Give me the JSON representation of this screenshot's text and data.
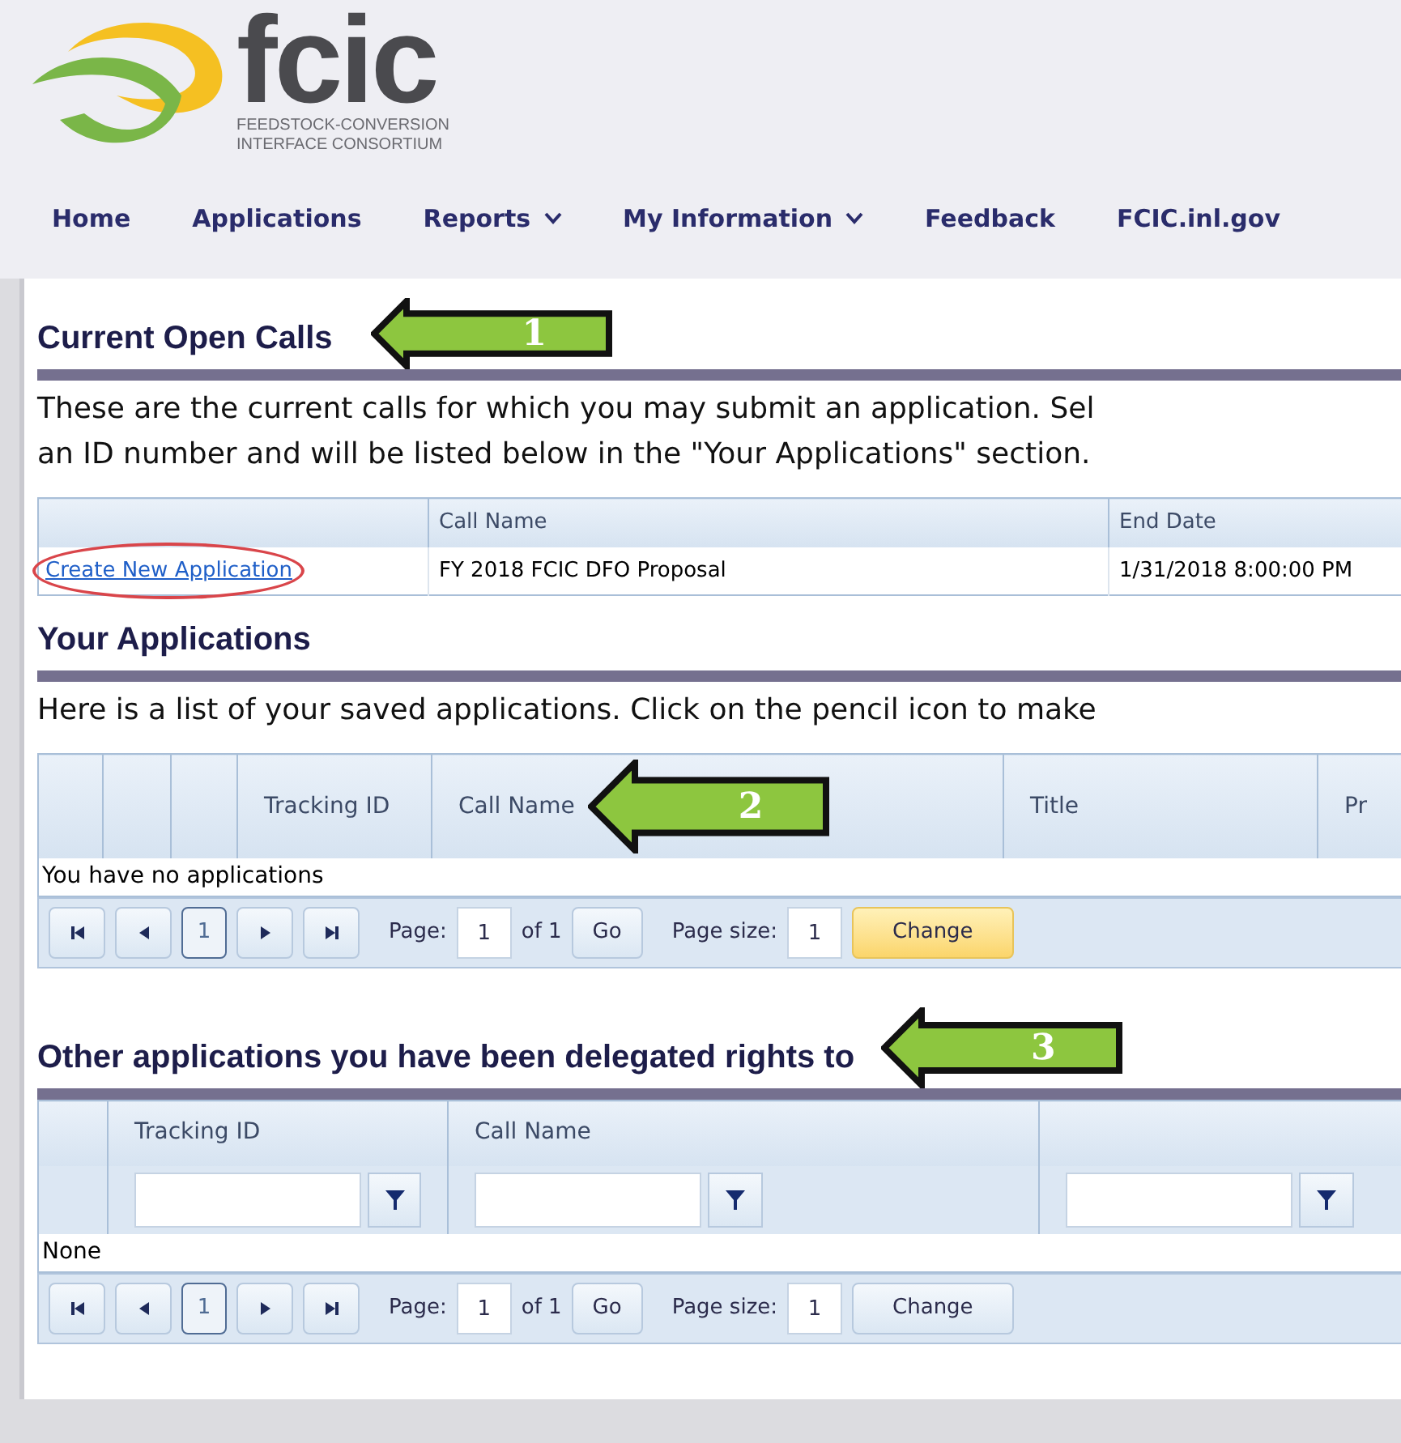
{
  "logo": {
    "name": "fcic",
    "tagline": [
      "FEEDSTOCK-CONVERSION",
      "INTERFACE CONSORTIUM"
    ]
  },
  "nav": [
    {
      "label": "Home",
      "has_menu": false
    },
    {
      "label": "Applications",
      "has_menu": false
    },
    {
      "label": "Reports",
      "has_menu": true
    },
    {
      "label": "My Information",
      "has_menu": true
    },
    {
      "label": "Feedback",
      "has_menu": false
    },
    {
      "label": "FCIC.inl.gov",
      "has_menu": false
    }
  ],
  "open_calls": {
    "title": "Current Open Calls",
    "callout": "1",
    "intro": [
      "These are the current calls for which you may submit an application. Sel",
      "an ID number and will be listed below in the \"Your Applications\" section."
    ],
    "columns": [
      {},
      {
        "label": "Call Name"
      },
      {
        "label": "End Date"
      }
    ],
    "rows": [
      {
        "link": "Create New Application",
        "circled": true,
        "call_name": "FY 2018 FCIC DFO Proposal",
        "end_date": "1/31/2018 8:00:00 PM"
      }
    ]
  },
  "your_applications": {
    "title": "Your Applications",
    "callout": "2",
    "intro": "Here is a list of your saved applications. Click on the pencil icon to make",
    "columns": [
      {},
      {},
      {},
      {
        "label": "Tracking ID"
      },
      {
        "label": "Call Name"
      },
      {
        "label": "Title"
      },
      {
        "label": "Pr"
      }
    ],
    "empty": "You have no applications",
    "pager": {
      "current": "1",
      "page_label": "Page:",
      "page_value": "1",
      "of": "of 1",
      "go": "Go",
      "size_label": "Page size:",
      "size_value": "1",
      "change": "Change",
      "change_highlighted": true
    }
  },
  "delegated": {
    "title": "Other applications you have been delegated rights to",
    "callout": "3",
    "columns": [
      {},
      {
        "label": "Tracking ID",
        "filter": true
      },
      {
        "label": "Call Name",
        "filter": true
      },
      {
        "filter": true
      }
    ],
    "empty": "None",
    "pager": {
      "current": "1",
      "page_label": "Page:",
      "page_value": "1",
      "of": "of 1",
      "go": "Go",
      "size_label": "Page size:",
      "size_value": "1",
      "change": "Change",
      "change_highlighted": false
    }
  }
}
